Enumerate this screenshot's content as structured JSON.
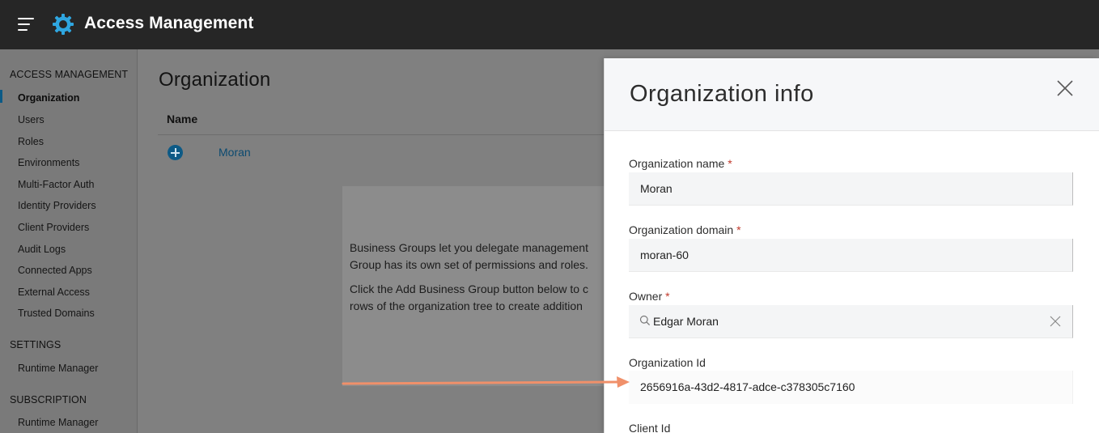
{
  "app": {
    "title": "Access Management",
    "brand_color": "#0d5a86"
  },
  "sidebar": {
    "sections": [
      {
        "label": "ACCESS MANAGEMENT"
      },
      {
        "label": "SETTINGS"
      },
      {
        "label": "SUBSCRIPTION"
      }
    ],
    "access_items": [
      {
        "label": "Organization",
        "active": true
      },
      {
        "label": "Users"
      },
      {
        "label": "Roles"
      },
      {
        "label": "Environments"
      },
      {
        "label": "Multi-Factor Auth"
      },
      {
        "label": "Identity Providers"
      },
      {
        "label": "Client Providers"
      },
      {
        "label": "Audit Logs"
      },
      {
        "label": "Connected Apps"
      },
      {
        "label": "External Access"
      },
      {
        "label": "Trusted Domains"
      }
    ],
    "settings_items": [
      {
        "label": "Runtime Manager"
      }
    ],
    "subscription_items": [
      {
        "label": "Runtime Manager"
      }
    ]
  },
  "main": {
    "title": "Organization",
    "table": {
      "column_name": "Name",
      "rows": [
        {
          "name": "Moran"
        }
      ]
    },
    "info": {
      "lines": [
        "Business Groups let you delegate management",
        "Group has its own set of permissions and roles.",
        "Click the Add Business Group button below to c",
        "rows of the organization tree to create addition"
      ]
    }
  },
  "panel": {
    "title": "Organization info",
    "fields": {
      "org_name": {
        "label": "Organization name",
        "required_mark": "*",
        "value": "Moran"
      },
      "org_domain": {
        "label": "Organization domain",
        "required_mark": "*",
        "value": "moran-60"
      },
      "owner": {
        "label": "Owner",
        "required_mark": "*",
        "value": "Edgar Moran"
      },
      "org_id": {
        "label": "Organization Id",
        "value": "2656916a-43d2-4817-adce-c378305c7160"
      },
      "client_id": {
        "label": "Client Id"
      }
    }
  },
  "annotation": {
    "arrow_color": "#f0906a"
  }
}
